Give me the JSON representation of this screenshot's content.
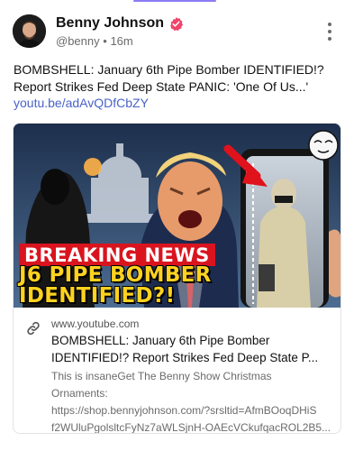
{
  "post": {
    "author_name": "Benny Johnson",
    "handle": "@benny",
    "separator": "•",
    "time": "16m",
    "text": "BOMBSHELL: January 6th Pipe Bomber IDENTIFIED!? Report Strikes Fed Deep State PANIC: 'One Of Us...'",
    "link": "youtu.be/adAvQDfCbZY"
  },
  "card": {
    "thumbnail_lines": [
      "BREAKING NEWS",
      "J6 PIPE BOMBER",
      "IDENTIFIED?!"
    ],
    "domain": "www.youtube.com",
    "title_line1": "BOMBSHELL: January 6th Pipe Bomber",
    "title_line2": "IDENTIFIED!?  Report Strikes Fed Deep State P...",
    "desc_line1": "This is insaneGet The Benny Show Christmas",
    "desc_line2": "Ornaments:",
    "desc_line3": "https://shop.bennyjohnson.com/?srsltid=AfmBOoqDHiS",
    "desc_line4": "f2WUluPgolsltcFyNz7aWLSjnH-OAEcVCkufqacROL2B5..."
  },
  "icons": {
    "verified": "verified-badge-icon",
    "more": "more-vertical-icon",
    "link": "link-icon"
  },
  "colors": {
    "link": "#4a63c9",
    "verified": "#f0446b",
    "breaking_red": "#d9141e",
    "headline_yellow": "#ffd21f"
  }
}
